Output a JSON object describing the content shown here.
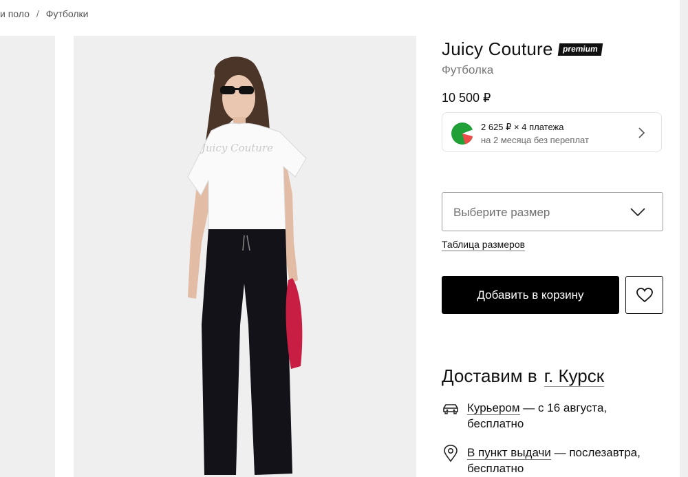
{
  "breadcrumb": {
    "items": [
      "и поло",
      "Футболки"
    ],
    "separator": "/"
  },
  "product": {
    "brand": "Juicy Couture",
    "badge": "premium",
    "type": "Футболка",
    "price": "10 500 ₽"
  },
  "split": {
    "line1": "2 625 ₽ × 4 платежа",
    "line2": "на 2 месяца без переплат",
    "icon": "split-logo-icon",
    "accent": "#21a038"
  },
  "size": {
    "placeholder": "Выберите размер",
    "table_link": "Таблица размеров"
  },
  "actions": {
    "add_to_cart": "Добавить в корзину",
    "favorite_icon": "heart-icon"
  },
  "delivery": {
    "heading": "Доставим в",
    "city": "г. Курск",
    "options": [
      {
        "icon": "car-icon",
        "link": "Курьером",
        "rest": " — с 16 августа,",
        "sub": "бесплатно"
      },
      {
        "icon": "map-pin-icon",
        "link": "В пункт выдачи",
        "rest": " — послезавтра,",
        "sub": "бесплатно"
      }
    ]
  },
  "colors": {
    "button_bg": "#000000",
    "photo_bg": "#efefef",
    "bag": "#c81e44"
  }
}
